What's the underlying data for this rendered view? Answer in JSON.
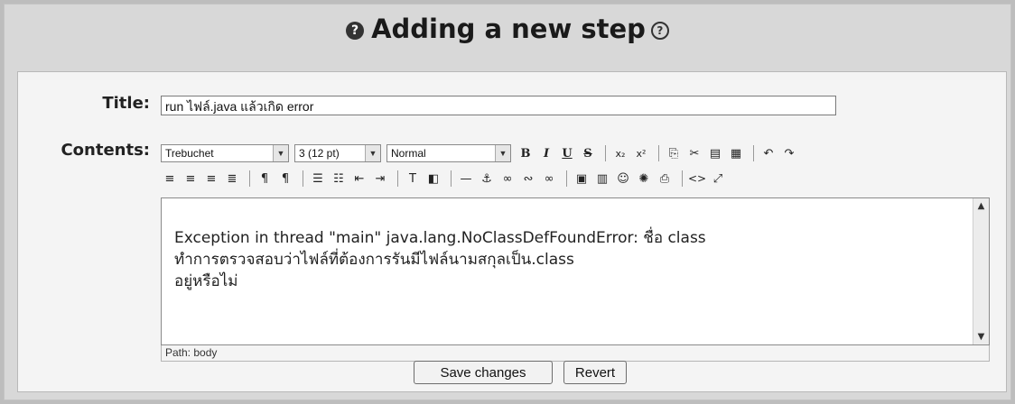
{
  "heading": {
    "title": "Adding a new step",
    "help_icon": "help-icon"
  },
  "form": {
    "title_label": "Title:",
    "title_value": "run ไฟล์.java แล้วเกิด error",
    "contents_label": "Contents:"
  },
  "toolbar": {
    "font": "Trebuchet",
    "size": "3 (12 pt)",
    "format": "Normal",
    "row1": [
      "B",
      "I",
      "U",
      "S",
      "x₂",
      "x²",
      "copy",
      "cut",
      "paste",
      "paste-word",
      "undo",
      "redo"
    ],
    "row2": [
      "align-left",
      "align-center",
      "align-right",
      "justify",
      "ltr",
      "rtl",
      "ordered-list",
      "unordered-list",
      "outdent",
      "indent",
      "text-color",
      "background-color",
      "horizontal-rule",
      "anchor",
      "link",
      "unlink",
      "nolink",
      "image",
      "table",
      "smiley",
      "special-char",
      "search-replace",
      "html",
      "fullscreen"
    ]
  },
  "editor": {
    "line1": "Exception in thread \"main\" java.lang.NoClassDefFoundError: ชื่อ class",
    "line2": "ทำการตรวจสอบว่าไฟล์ที่ต้องการรันมีไฟล์นามสกุลเป็น.class",
    "line3": "อยู่หรือไม่",
    "path": "Path:  body"
  },
  "buttons": {
    "save": "Save changes",
    "revert": "Revert"
  }
}
